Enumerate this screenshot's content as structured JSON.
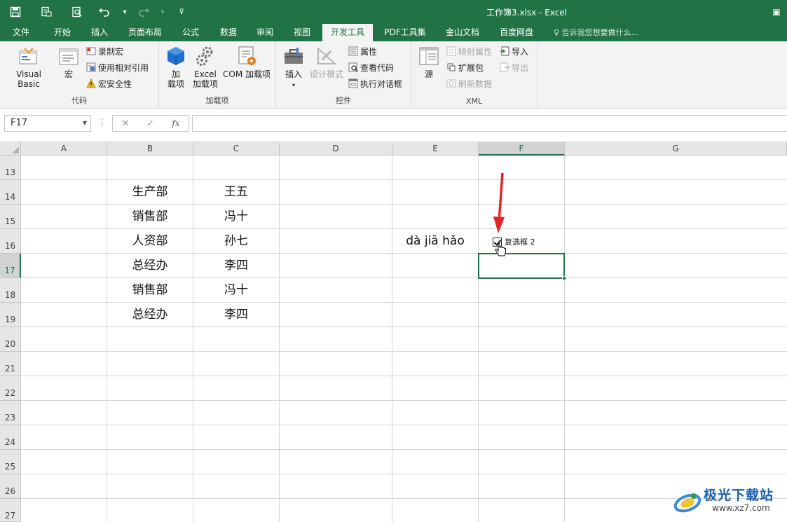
{
  "window": {
    "title": "工作簿3.xlsx - Excel"
  },
  "qat": {
    "save": "save-icon",
    "print_preview": "print-preview-icon",
    "preview": "preview-icon",
    "undo": "undo-icon",
    "redo": "redo-icon",
    "customize": "customize-qat-icon"
  },
  "tabs": [
    {
      "label": "文件"
    },
    {
      "label": "开始"
    },
    {
      "label": "插入"
    },
    {
      "label": "页面布局"
    },
    {
      "label": "公式"
    },
    {
      "label": "数据"
    },
    {
      "label": "审阅"
    },
    {
      "label": "视图"
    },
    {
      "label": "开发工具",
      "active": true
    },
    {
      "label": "PDF工具集"
    },
    {
      "label": "金山文档"
    },
    {
      "label": "百度网盘"
    }
  ],
  "tell_me": "告诉我您想要做什么...",
  "ribbon": {
    "code": {
      "label": "代码",
      "visual_basic": "Visual Basic",
      "macro": "宏",
      "record_macro": "录制宏",
      "relative_ref": "使用相对引用",
      "macro_security": "宏安全性"
    },
    "addins": {
      "label": "加载项",
      "addin_line1": "加",
      "addin_line2": "载项",
      "excel_addin_line1": "Excel",
      "excel_addin_line2": "加载项",
      "com_addin": "COM 加载项"
    },
    "controls": {
      "label": "控件",
      "insert": "插入",
      "design_mode": "设计模式",
      "properties": "属性",
      "view_code": "查看代码",
      "run_dialog": "执行对话框"
    },
    "xml": {
      "label": "XML",
      "source": "源",
      "map_properties": "映射属性",
      "expansion_packs": "扩展包",
      "refresh_data": "刷新数据",
      "import": "导入",
      "export": "导出"
    }
  },
  "formula_bar": {
    "name_box": "F17",
    "cancel": "✕",
    "enter": "✓",
    "fx": "fx",
    "content": ""
  },
  "sheet": {
    "columns": [
      "A",
      "B",
      "C",
      "D",
      "E",
      "F",
      "G"
    ],
    "selected_column": "F",
    "rows": [
      "13",
      "14",
      "15",
      "16",
      "17",
      "18",
      "19",
      "20",
      "21",
      "22",
      "23",
      "24",
      "25",
      "26",
      "27"
    ],
    "selected_row": "17",
    "cells": {
      "B14": "生产部",
      "C14": "王五",
      "B15": "销售部",
      "C15": "冯十",
      "B16": "人资部",
      "C16": "孙七",
      "B17": "总经办",
      "C17": "李四",
      "B18": "销售部",
      "C18": "冯十",
      "B19": "总经办",
      "C19": "李四",
      "E16": "dà jiā hǎo"
    },
    "checkbox": {
      "label": "复选框 2",
      "checked": true
    }
  },
  "watermark": {
    "title": "极光下载站",
    "url": "www.xz7.com"
  },
  "colors": {
    "excel_green": "#217346",
    "annotation_red": "#e0262b"
  }
}
